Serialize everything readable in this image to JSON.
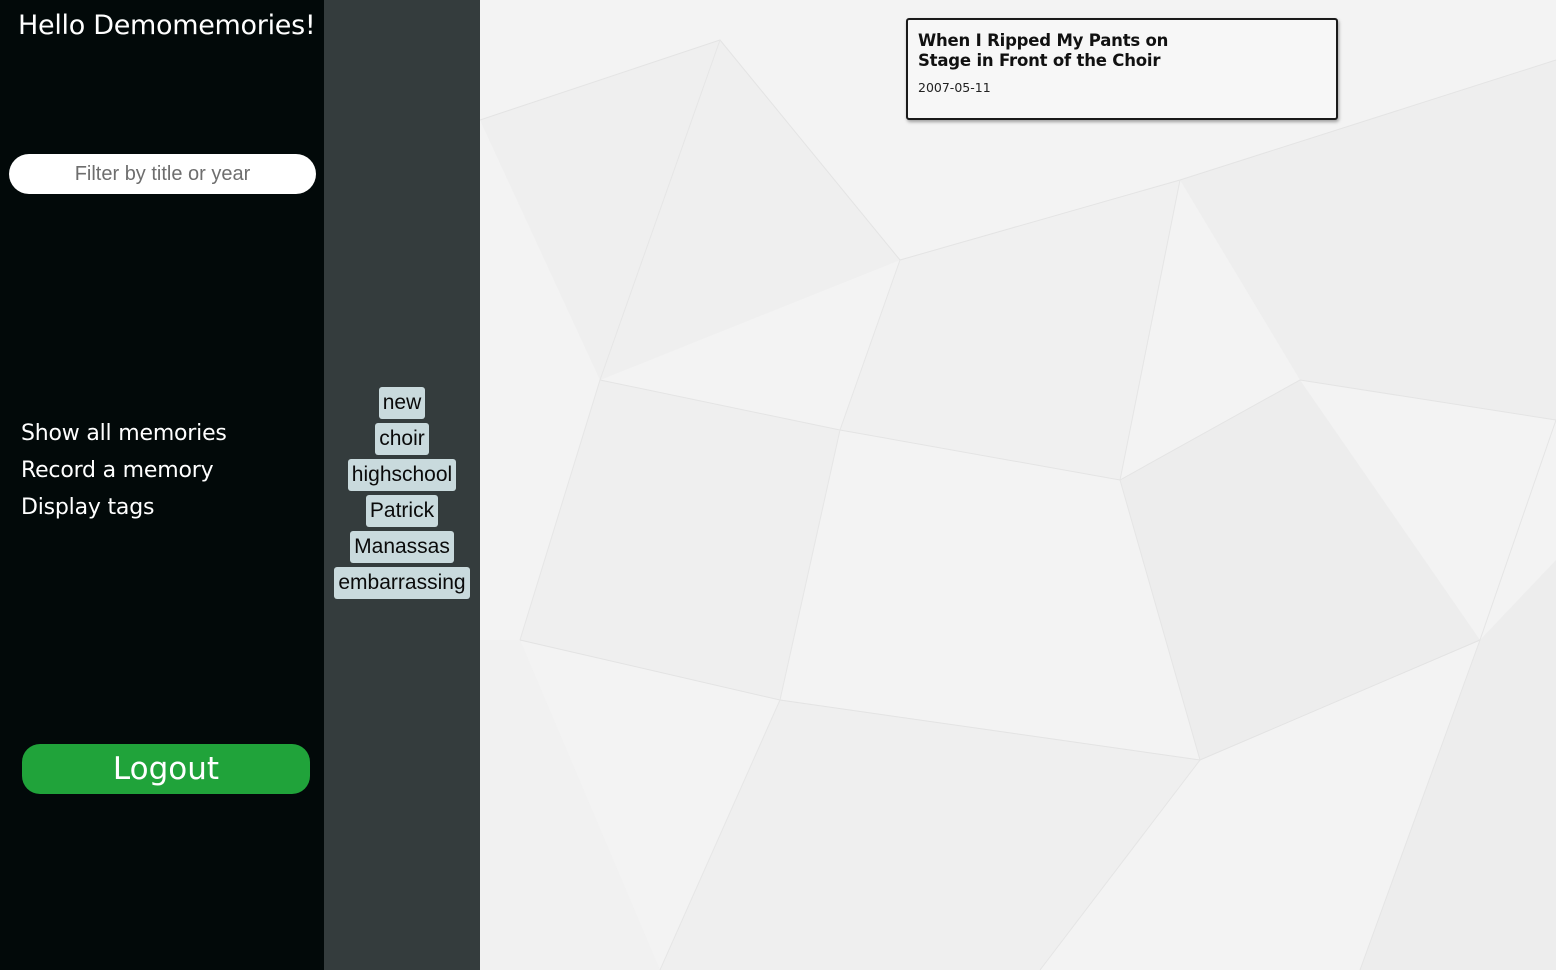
{
  "header": {
    "greeting": "Hello Demomemories!"
  },
  "search": {
    "placeholder": "Filter by title or year",
    "value": ""
  },
  "nav": {
    "items": [
      {
        "label": "Show all memories"
      },
      {
        "label": "Record a memory"
      },
      {
        "label": "Display tags"
      }
    ]
  },
  "logout": {
    "label": "Logout"
  },
  "tags": [
    "new",
    "choir",
    "highschool",
    "Patrick",
    "Manassas",
    "embarrassing"
  ],
  "memories": [
    {
      "title": "When I Ripped My Pants on Stage in Front of the Choir",
      "date": "2007-05-11"
    }
  ],
  "colors": {
    "sidebar_bg": "#020909",
    "tag_column_bg": "#343c3d",
    "tag_bg": "#c9dadd",
    "logout_bg": "#20a33a",
    "main_bg": "#f2f2f2"
  }
}
